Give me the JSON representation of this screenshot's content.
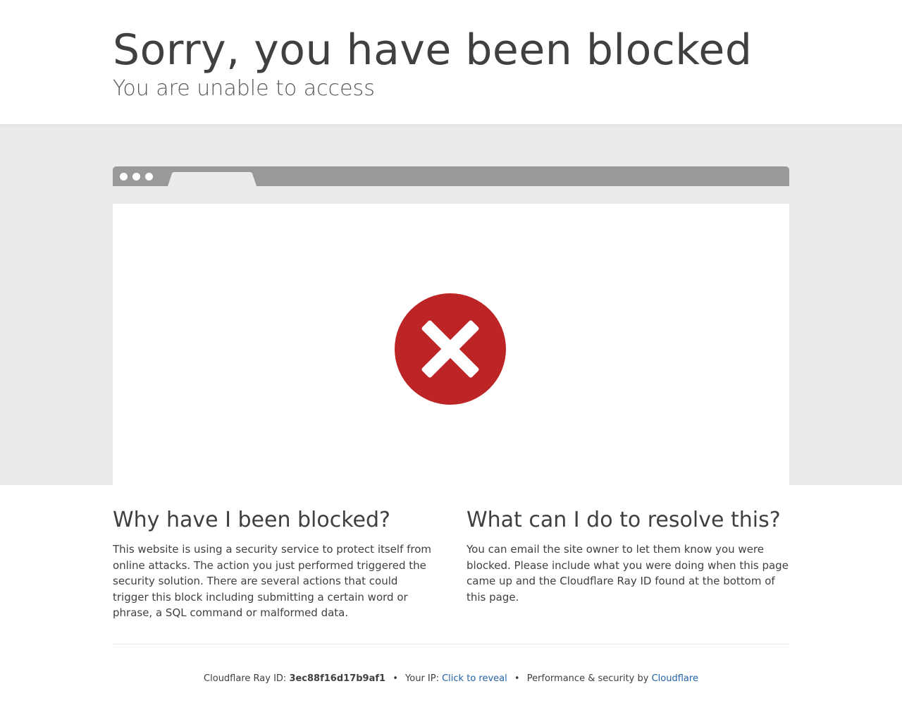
{
  "header": {
    "title": "Sorry, you have been blocked",
    "subtitle": "You are unable to access"
  },
  "illustration": {
    "icon": "error-x-circle-icon",
    "circle_color": "#bd2426",
    "bar_color": "#999999",
    "band_color": "#ebebeb"
  },
  "why": {
    "heading": "Why have I been blocked?",
    "body": "This website is using a security service to protect itself from online attacks. The action you just performed triggered the security solution. There are several actions that could trigger this block including submitting a certain word or phrase, a SQL command or malformed data."
  },
  "resolve": {
    "heading": "What can I do to resolve this?",
    "body": "You can email the site owner to let them know you were blocked. Please include what you were doing when this page came up and the Cloudflare Ray ID found at the bottom of this page."
  },
  "footer": {
    "ray_label": "Cloudflare Ray ID:",
    "ray_id": "3ec88f16d17b9af1",
    "separator": "•",
    "ip_label": "Your IP:",
    "ip_link": "Click to reveal",
    "perf_label": "Performance & security by",
    "cf_link": "Cloudflare",
    "link_color": "#2563a8"
  }
}
